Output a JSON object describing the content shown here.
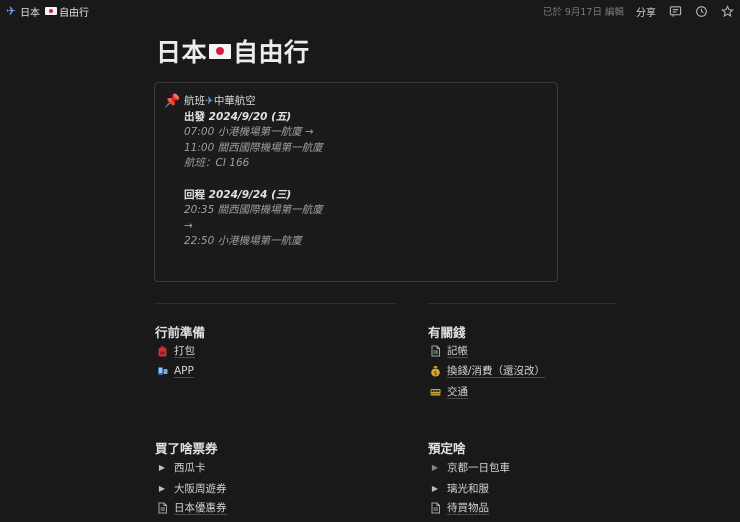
{
  "topbar": {
    "breadcrumb_icon": "airplane-icon",
    "breadcrumb_title_a": "日本",
    "breadcrumb_title_b": "自由行",
    "edited_text": "已於 9月17日 編輯",
    "share_label": "分享",
    "icons": [
      "comment-icon",
      "history-icon",
      "star-icon"
    ]
  },
  "page": {
    "title_a": "日本",
    "title_b": "自由行"
  },
  "callout": {
    "icon": "pushpin-icon",
    "heading_a": "航班",
    "heading_b": "中華航空",
    "out_label": "出發 ",
    "out_date": "2024/9/20 (五)",
    "out_line1": "07:00 小港機場第一航廈 →",
    "out_line2": "11:00 關西國際機場第一航廈",
    "flight_no": "航班：CI 166",
    "ret_label": "回程 ",
    "ret_date": "2024/9/24 (三)",
    "ret_line1": "20:35 關西國際機場第一航廈",
    "ret_line2": "→",
    "ret_line3": "22:50 小港機場第一航廈"
  },
  "sections": {
    "prep": {
      "title": "行前準備",
      "items": [
        {
          "label": "打包",
          "icon": "backpack-icon"
        },
        {
          "label": "APP",
          "icon": "app-icon"
        }
      ]
    },
    "money": {
      "title": "有關錢",
      "items": [
        {
          "label": "記帳",
          "icon": "page-icon"
        },
        {
          "label": "換錢/消費（還沒改）",
          "icon": "moneybag-icon"
        },
        {
          "label": "交通",
          "icon": "train-icon"
        }
      ]
    },
    "tickets": {
      "title": "買了啥票券",
      "items": [
        {
          "label": "西瓜卡",
          "icon": "toggle-triangle-icon"
        },
        {
          "label": "大阪周遊券",
          "icon": "toggle-triangle-icon"
        },
        {
          "label": "日本優惠券",
          "icon": "page-icon"
        }
      ]
    },
    "booked": {
      "title": "預定啥",
      "items": [
        {
          "label": "京都一日包車",
          "icon": "toggle-triangle-icon"
        },
        {
          "label": "璃光和服",
          "icon": "toggle-triangle-icon"
        },
        {
          "label": "待買物品",
          "icon": "page-icon"
        }
      ]
    }
  }
}
